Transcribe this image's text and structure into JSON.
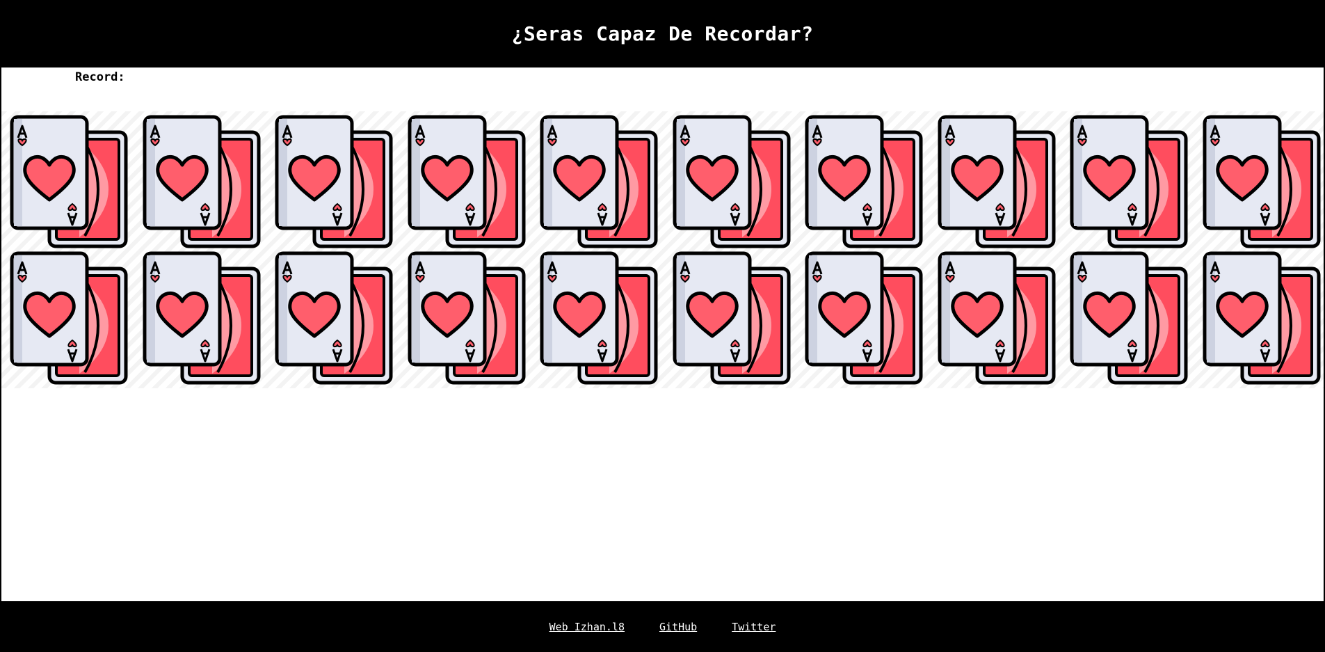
{
  "header": {
    "title": "¿Seras Capaz De Recordar?"
  },
  "record": {
    "label": "Record:",
    "value": ""
  },
  "board": {
    "rows": 2,
    "columns": 10,
    "card_back_icon": "ace-of-hearts-card-back-icon",
    "colors": {
      "card_face": "#e6e9f3",
      "card_shadow": "#cdd2e1",
      "heart": "#ff5e6c",
      "back_card": "#ff4d5e",
      "back_card_light": "#ffa3ab",
      "outline": "#000000"
    }
  },
  "footer": {
    "links": [
      {
        "label": "Web Izhan.l8"
      },
      {
        "label": "GitHub"
      },
      {
        "label": "Twitter"
      }
    ]
  }
}
